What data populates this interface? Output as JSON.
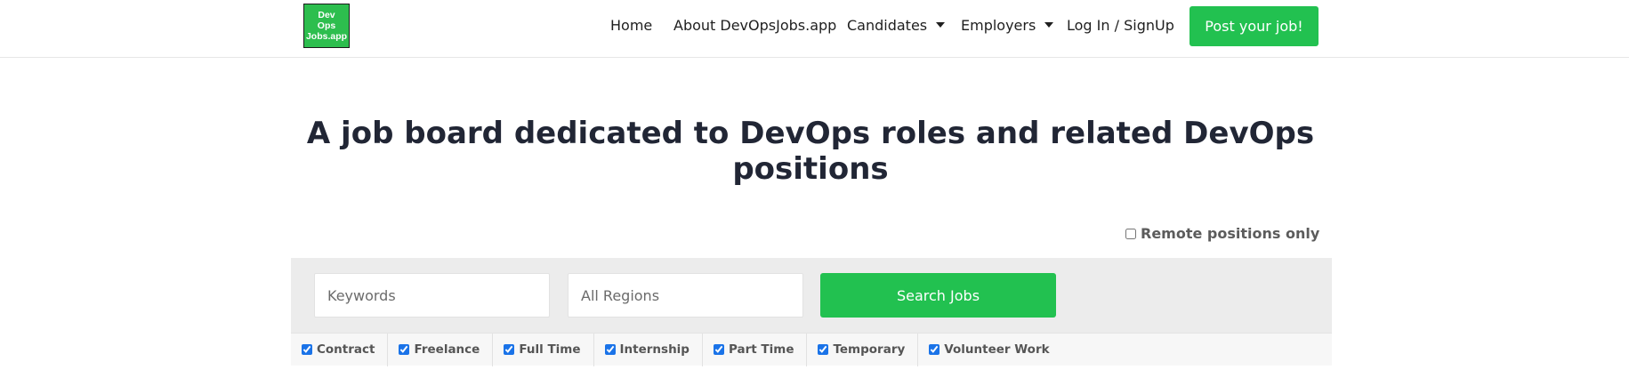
{
  "header": {
    "logo_text": "Dev\nOps\nJobs.app",
    "nav": [
      {
        "label": "Home"
      },
      {
        "label": "About DevOpsJobs.app"
      },
      {
        "label": "Candidates",
        "has_dropdown": true
      },
      {
        "label": "Employers",
        "has_dropdown": true
      },
      {
        "label": "Log In / SignUp"
      }
    ],
    "post_button": "Post your job!"
  },
  "hero": {
    "title": "A job board dedicated to DevOps roles and related DevOps positions"
  },
  "search": {
    "remote_label": "Remote positions only",
    "remote_checked": false,
    "keywords_placeholder": "Keywords",
    "regions_placeholder": "All Regions",
    "search_button": "Search Jobs",
    "job_types": [
      {
        "label": "Contract",
        "checked": true
      },
      {
        "label": "Freelance",
        "checked": true
      },
      {
        "label": "Full Time",
        "checked": true
      },
      {
        "label": "Internship",
        "checked": true
      },
      {
        "label": "Part Time",
        "checked": true
      },
      {
        "label": "Temporary",
        "checked": true
      },
      {
        "label": "Volunteer Work",
        "checked": true
      }
    ]
  },
  "colors": {
    "accent": "#22c150",
    "logo_bg": "#2dbe4e",
    "title": "#212635",
    "search_panel": "#ececec"
  }
}
